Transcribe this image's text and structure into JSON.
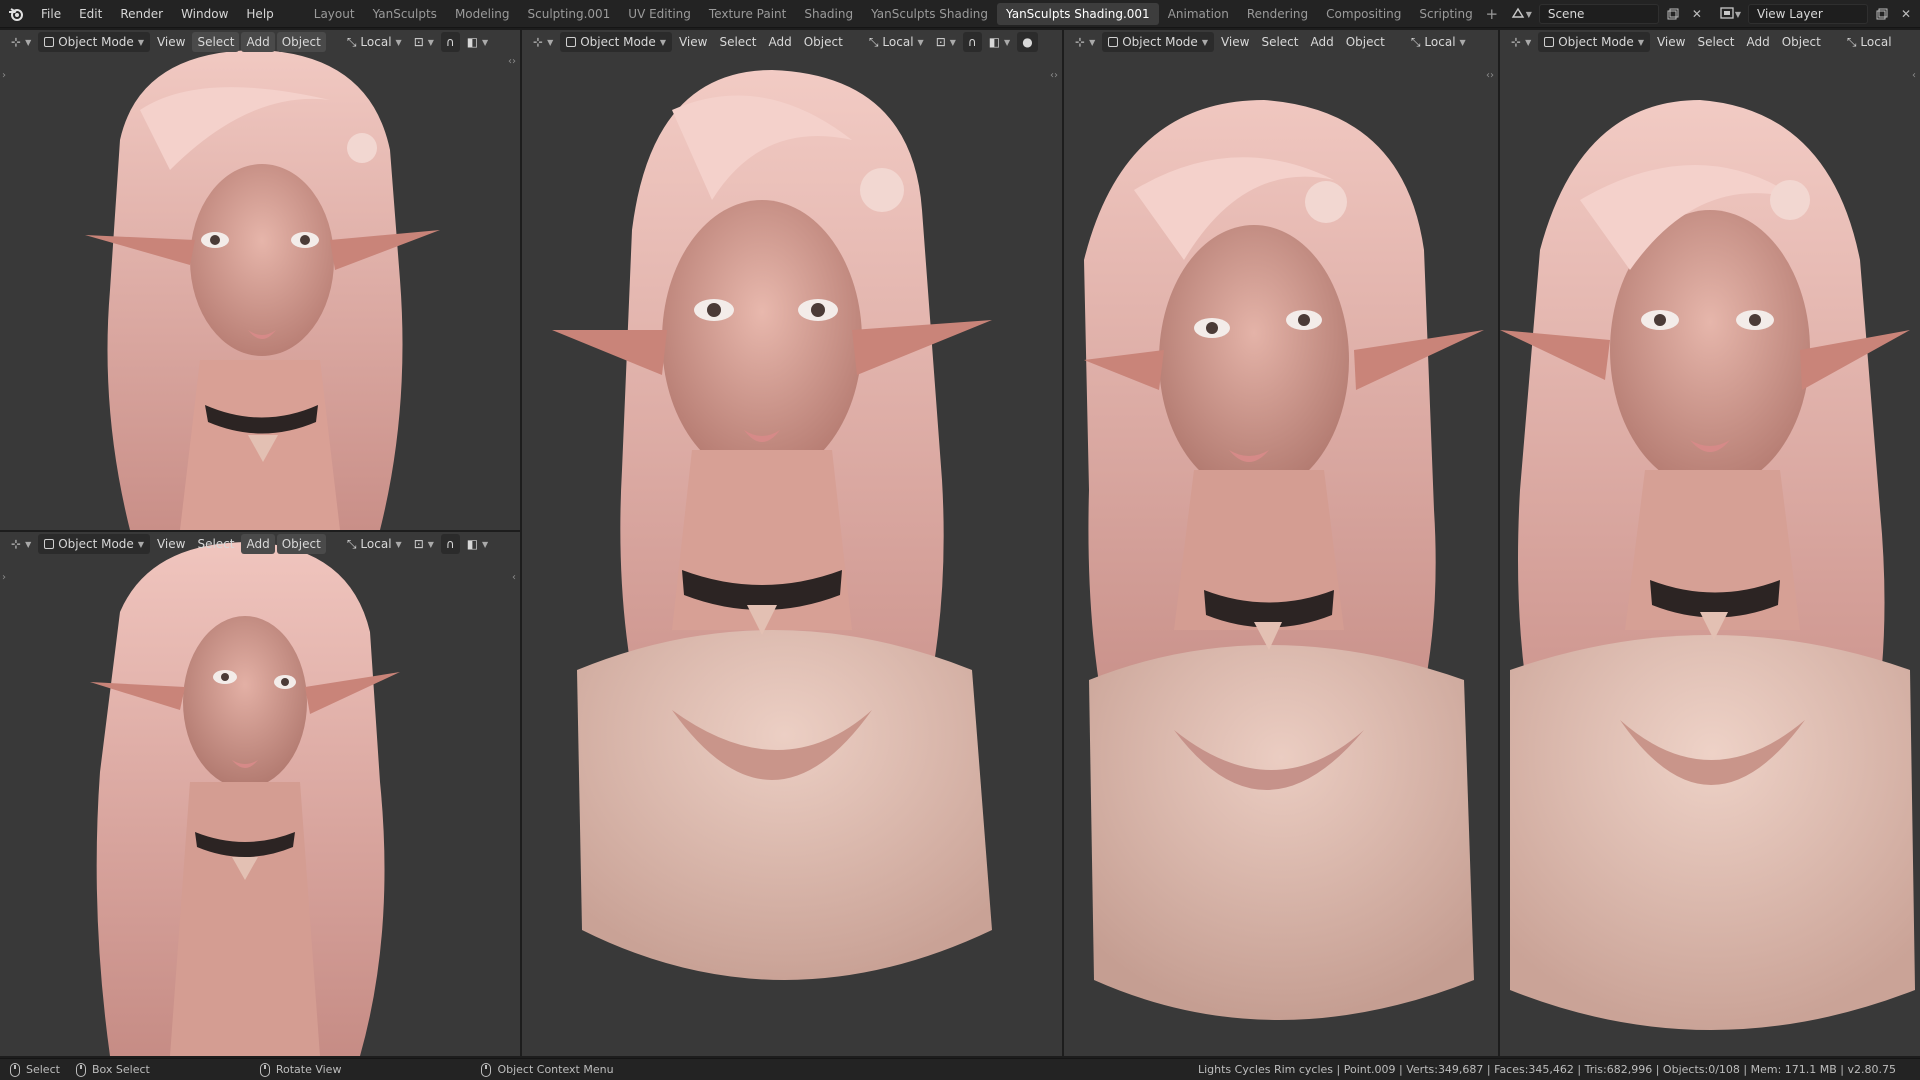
{
  "app": {
    "menus": [
      "File",
      "Edit",
      "Render",
      "Window",
      "Help"
    ],
    "workspaces": [
      "Layout",
      "YanSculpts",
      "Modeling",
      "Sculpting.001",
      "UV Editing",
      "Texture Paint",
      "Shading",
      "YanSculpts Shading",
      "YanSculpts Shading.001",
      "Animation",
      "Rendering",
      "Compositing",
      "Scripting"
    ],
    "active_workspace": "YanSculpts Shading.001",
    "add_workspace": "+",
    "scene": "Scene",
    "view_layer": "View Layer"
  },
  "viewport_header": {
    "mode": "Object Mode",
    "view": "View",
    "select": "Select",
    "add": "Add",
    "object": "Object",
    "orientation": "Local"
  },
  "statusbar": {
    "select": "Select",
    "box_select": "Box Select",
    "rotate_view": "Rotate View",
    "context_menu": "Object Context Menu",
    "stats": "Lights Cycles Rim cycles | Point.009 | Verts:349,687 | Faces:345,462 | Tris:682,996 | Objects:0/108 | Mem: 171.1 MB | v2.80.75"
  },
  "colors": {
    "skin": "#d9a49a",
    "hair": "#e8b9b2",
    "cloth": "#e3c0b3",
    "background": "#393939"
  },
  "icons": {
    "logo": "blender-logo-icon",
    "viewport_type": "3d-viewport-icon",
    "transform": "transform-orientation-icon",
    "pivot": "pivot-point-icon",
    "overlay": "overlay-icon",
    "shading": "shading-icon"
  }
}
